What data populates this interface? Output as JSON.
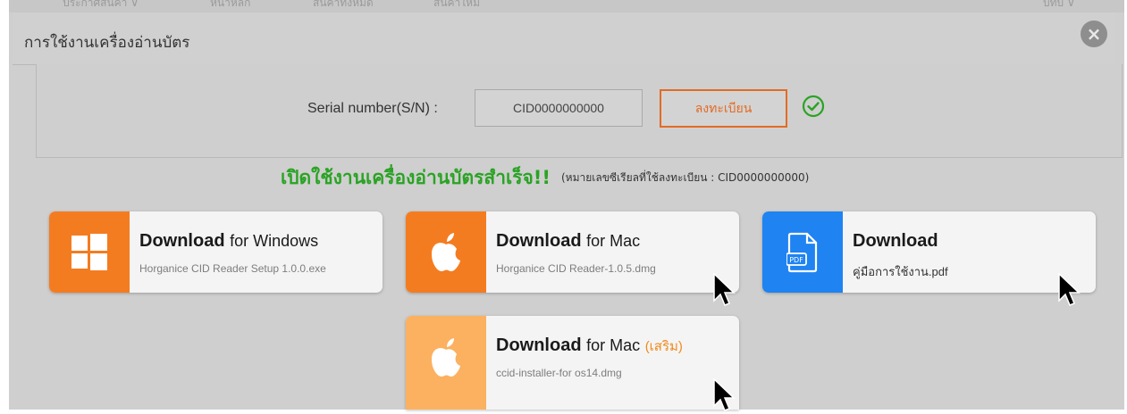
{
  "topbar": {
    "items": [
      "ประกาศสินค้า ∨",
      "หน้าหลัก",
      "สินค้าทั้งหมด",
      "สินค้าใหม่",
      "บทบ ∨"
    ]
  },
  "modal": {
    "title": "การใช้งานเครื่องอ่านบัตร",
    "close_icon": "×"
  },
  "serial": {
    "label": "Serial number(S/N) :",
    "value": "CID0000000000",
    "register_label": "ลงทะเบียน"
  },
  "status": {
    "message": "เปิดใช้งานเครื่องอ่านบัตรสำเร็จ!!",
    "detail": "(หมายเลขซีเรียลที่ใช้ลงทะเบียน : CID0000000000)"
  },
  "downloads": [
    {
      "title": "Download",
      "platform": "for Windows",
      "extra": "",
      "file": "Horganice CID Reader Setup 1.0.0.exe",
      "icon": "windows-icon",
      "color": "#f47c20"
    },
    {
      "title": "Download",
      "platform": "for Mac",
      "extra": "",
      "file": "Horganice CID Reader-1.0.5.dmg",
      "icon": "apple-icon",
      "color": "#f47c20"
    },
    {
      "title": "Download",
      "platform": "",
      "extra": "",
      "file": "คู่มือการใช้งาน.pdf",
      "icon": "pdf-icon",
      "color": "#1f83f2"
    },
    {
      "title": "Download",
      "platform": "for Mac",
      "extra": "(เสริม)",
      "file": "ccid-installer-for os14.dmg",
      "icon": "apple-icon",
      "color": "#fbb160"
    }
  ],
  "colors": {
    "success": "#2aa324",
    "accent": "#e36b24"
  }
}
